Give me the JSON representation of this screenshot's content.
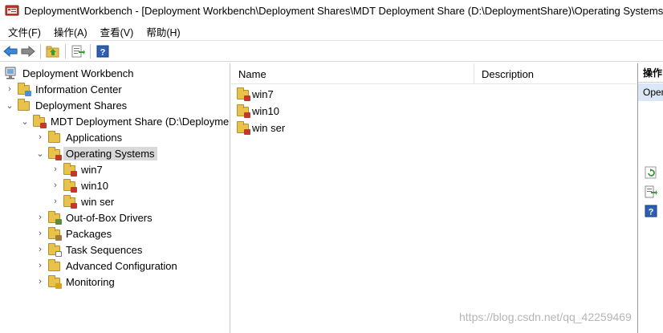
{
  "window": {
    "title": "DeploymentWorkbench - [Deployment Workbench\\Deployment Shares\\MDT Deployment Share (D:\\DeploymentShare)\\Operating Systems]"
  },
  "menu": {
    "items": [
      "文件(F)",
      "操作(A)",
      "查看(V)",
      "帮助(H)"
    ]
  },
  "toolbar": {
    "icons": [
      "back-arrow-icon",
      "forward-arrow-icon",
      "up-folder-icon",
      "export-list-icon",
      "help-icon"
    ]
  },
  "tree": {
    "root": "Deployment Workbench",
    "information_center": "Information Center",
    "deployment_shares": "Deployment Shares",
    "mdt_share": "MDT Deployment Share (D:\\DeploymentShare)",
    "applications": "Applications",
    "operating_systems": "Operating Systems",
    "os_children": [
      "win7",
      "win10",
      "win ser"
    ],
    "out_of_box_drivers": "Out-of-Box Drivers",
    "packages": "Packages",
    "task_sequences": "Task Sequences",
    "advanced_configuration": "Advanced Configuration",
    "monitoring": "Monitoring"
  },
  "list": {
    "columns": [
      "Name",
      "Description"
    ],
    "rows": [
      {
        "name": "win7",
        "description": ""
      },
      {
        "name": "win10",
        "description": ""
      },
      {
        "name": "win ser",
        "description": ""
      }
    ]
  },
  "actions": {
    "header": "操作",
    "subheader": "Operating Systems"
  },
  "watermark": "https://blog.csdn.net/qq_42259469",
  "colors": {
    "folder": "#e8c24b",
    "selection": "#d9d9d9",
    "action_highlight": "#dbe7f7"
  }
}
